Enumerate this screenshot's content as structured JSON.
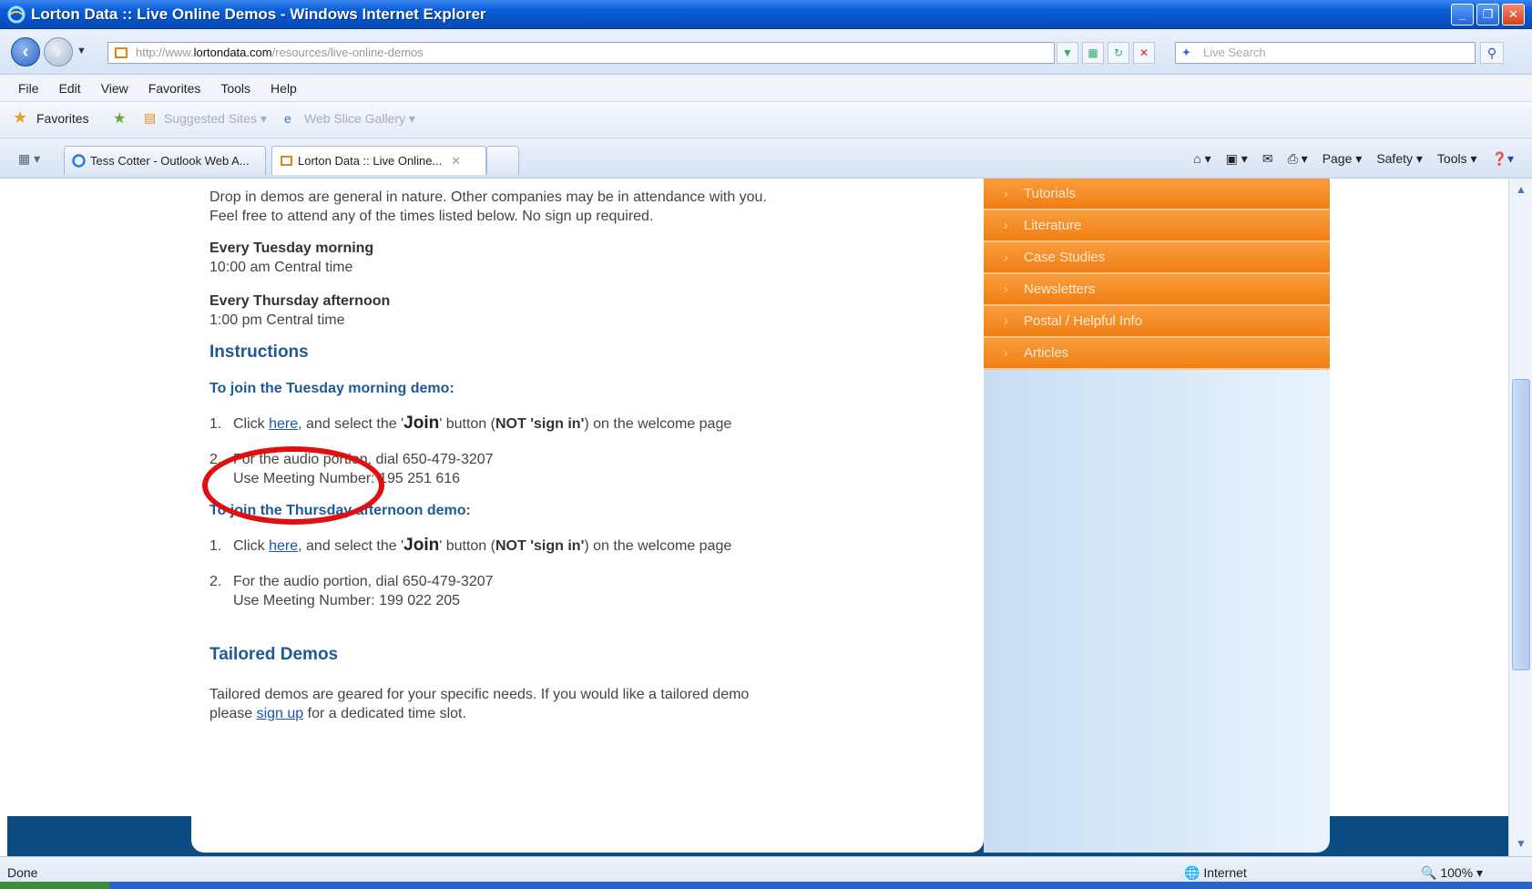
{
  "window": {
    "title": "Lorton Data :: Live Online Demos - Windows Internet Explorer",
    "buttons": [
      "minimize",
      "maximize",
      "close"
    ]
  },
  "addressbar": {
    "url_prefix": "http://www.",
    "url_host": "lortondata.com",
    "url_path": "/resources/live-online-demos",
    "search_placeholder": "Live Search"
  },
  "menu": [
    "File",
    "Edit",
    "View",
    "Favorites",
    "Tools",
    "Help"
  ],
  "favorites_bar": {
    "favorites_label": "Favorites",
    "suggested_sites": "Suggested Sites ▾",
    "web_slice": "Web Slice Gallery ▾"
  },
  "tabs": [
    {
      "label": "Tess Cotter - Outlook Web A..."
    },
    {
      "label": "Lorton Data :: Live Online...",
      "close": "✕"
    }
  ],
  "command_bar": [
    "Page ▾",
    "Safety ▾",
    "Tools ▾"
  ],
  "content": {
    "intro_line1": "Drop in demos are general in nature.  Other companies may be in attendance with you.",
    "intro_line2": "Feel free to attend any of the times listed below.  No sign up required.",
    "tuesday_heading": "Every Tuesday morning",
    "tuesday_time": "10:00 am Central time",
    "thursday_heading": "Every Thursday afternoon",
    "thursday_time": "1:00 pm Central time",
    "instructions_heading": "Instructions",
    "tuesday_join_heading": "To join the Tuesday morning demo:",
    "step1_num": "1.",
    "step1_pre": "Click ",
    "step1_link": "here",
    "step1_mid": ", and select the '",
    "step1_join": "Join",
    "step1_mid2": "' button (",
    "step1_not": "NOT",
    "step1_signin": " 'sign in'",
    "step1_post": ") on the welcome page",
    "step2_num": "2.",
    "step2_line1": "For the audio portion, dial 650-479-3207",
    "tuesday_meeting": "Use Meeting Number: 195 251 616",
    "thursday_join_heading": "To join the Thursday afternoon demo:",
    "thursday_meeting": "Use Meeting Number: 199 022 205",
    "tailored_heading": "Tailored Demos",
    "tailored_line1": "Tailored demos are geared for your specific needs. If you would like a tailored demo",
    "tailored_line2_pre": "please ",
    "tailored_link": "sign up",
    "tailored_line2_post": " for a dedicated time slot."
  },
  "sidebar": {
    "items": [
      "Tutorials",
      "Literature",
      "Case Studies",
      "Newsletters",
      "Postal / Helpful Info",
      "Articles"
    ]
  },
  "statusbar": {
    "status": "Done",
    "zone": "Internet",
    "zoom": "100%"
  },
  "colors": {
    "accent_orange": "#f07f14",
    "heading_blue": "#1f5a96",
    "annotation_red": "#e01010"
  }
}
